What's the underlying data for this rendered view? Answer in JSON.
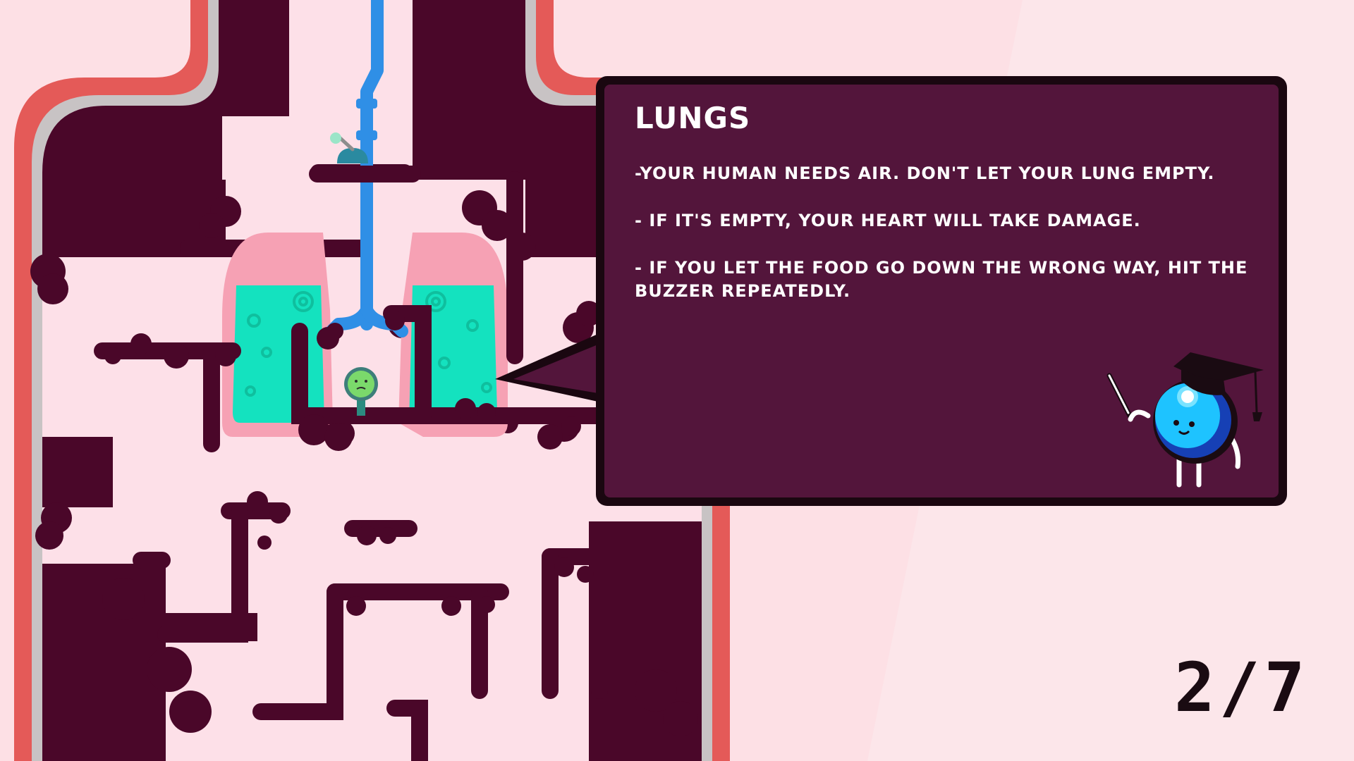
{
  "tutorial": {
    "title": "LUNGS",
    "tips": [
      "-YOUR HUMAN NEEDS AIR. DON'T LET YOUR LUNG EMPTY.",
      "- IF IT'S EMPTY, YOUR HEART WILL TAKE DAMAGE.",
      "- IF YOU LET THE FOOD GO DOWN THE WRONG WAY, HIT THE BUZZER REPEATEDLY."
    ]
  },
  "page": {
    "current": 2,
    "total": 7,
    "label": "2/7"
  },
  "colors": {
    "background": "#fde0e5",
    "body_outline_red": "#e45a58",
    "body_outline_gray": "#c8c3c4",
    "body_interior": "#fde0e8",
    "tissue": "#4a0729",
    "lung": "#f6a1b4",
    "lung_fluid": "#14e2bf",
    "trachea": "#2f8fe6",
    "panel": "#58173f",
    "panel_border": "#1a0710",
    "mascot": "#1ec3ff"
  },
  "icons": {
    "buzzer": "buzzer-lever-icon",
    "player": "microbe-player-icon",
    "mascot": "professor-eyeball-mascot-icon"
  }
}
